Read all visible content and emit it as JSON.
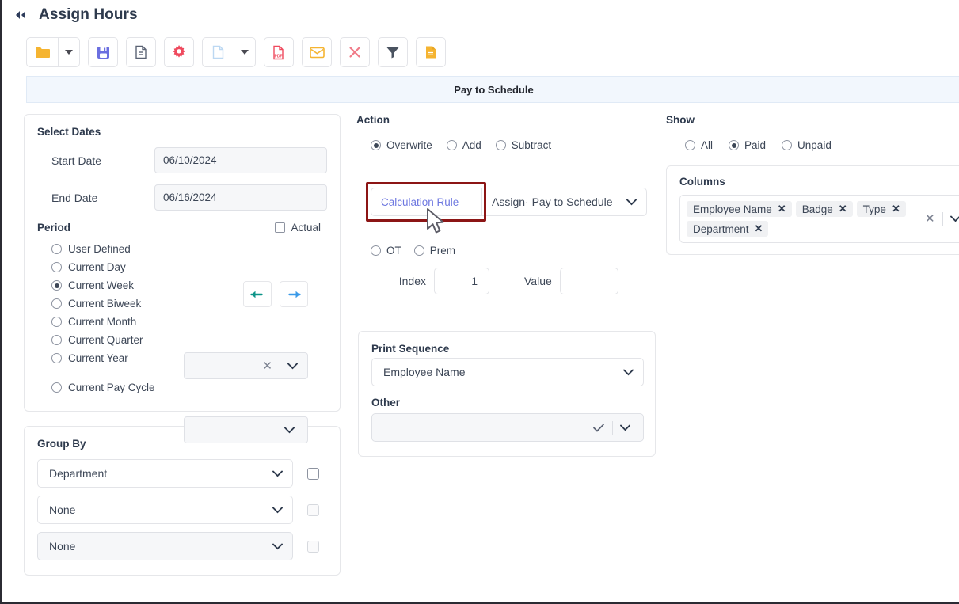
{
  "window": {
    "collapse_icon": "double-chevron-left-icon",
    "title": "Assign Hours"
  },
  "toolbar": {
    "buttons": [
      {
        "name": "open-folder-button",
        "icon": "folder-icon",
        "color": "#f5b431",
        "has_caret": true
      },
      {
        "name": "save-button",
        "icon": "floppy-disk-icon",
        "color": "#6b6fe0",
        "has_caret": false
      },
      {
        "name": "report-button",
        "icon": "document-lines-icon",
        "color": "#5b6374",
        "has_caret": false
      },
      {
        "name": "settings-button",
        "icon": "gear-icon",
        "color": "#ef4a5e",
        "has_caret": false
      },
      {
        "name": "new-document-button",
        "icon": "blank-page-icon",
        "color": "#bcd8f2",
        "has_caret": true
      },
      {
        "name": "export-pdf-button",
        "icon": "pdf-icon",
        "color": "#ef4a5e",
        "has_caret": false
      },
      {
        "name": "email-button",
        "icon": "envelope-icon",
        "color": "#f5b431",
        "has_caret": false
      },
      {
        "name": "delete-button",
        "icon": "close-x-icon",
        "color": "#f07a87",
        "has_caret": false
      },
      {
        "name": "filter-button",
        "icon": "funnel-icon",
        "color": "#5b6374",
        "has_caret": false
      },
      {
        "name": "notes-button",
        "icon": "document-orange-icon",
        "color": "#f5b431",
        "has_caret": false
      }
    ]
  },
  "section": {
    "title": "Pay to Schedule"
  },
  "select_dates": {
    "title": "Select Dates",
    "start_label": "Start Date",
    "start_value": "06/10/2024",
    "end_label": "End Date",
    "end_value": "06/16/2024",
    "period_label": "Period",
    "actual_label": "Actual",
    "actual_checked": false,
    "periods": [
      {
        "label": "User Defined",
        "checked": false
      },
      {
        "label": "Current Day",
        "checked": false
      },
      {
        "label": "Current Week",
        "checked": true
      },
      {
        "label": "Current Biweek",
        "checked": false
      },
      {
        "label": "Current Month",
        "checked": false
      },
      {
        "label": "Current Quarter",
        "checked": false
      },
      {
        "label": "Current Year",
        "checked": false
      }
    ],
    "pay_cycle": {
      "label": "Current Pay Cycle",
      "checked": false,
      "value": ""
    },
    "quarter_year_select_value": "",
    "prev_arrow_color": "#0d9488",
    "next_arrow_color": "#3b9ae8"
  },
  "group_by": {
    "title": "Group By",
    "rows": [
      {
        "value": "Department",
        "checked": false,
        "muted": false
      },
      {
        "value": "None",
        "checked": false,
        "muted": true
      },
      {
        "value": "None",
        "checked": false,
        "muted": true
      }
    ]
  },
  "action": {
    "title": "Action",
    "options": [
      {
        "label": "Overwrite",
        "checked": true
      },
      {
        "label": "Add",
        "checked": false
      },
      {
        "label": "Subtract",
        "checked": false
      }
    ],
    "calculation_rule_button": "Calculation Rule",
    "calculation_rule_select": "Assign· Pay to Schedule",
    "highlight_color": "#8c1515",
    "link_color": "#6e78e0",
    "ot_prem": [
      {
        "label": "OT",
        "checked": false
      },
      {
        "label": "Prem",
        "checked": false
      }
    ],
    "index_label": "Index",
    "index_value": "1",
    "value_label": "Value",
    "value_value": ""
  },
  "print_sequence": {
    "title": "Print Sequence",
    "sequence_value": "Employee Name",
    "other_label": "Other",
    "other_value": ""
  },
  "show": {
    "title": "Show",
    "options": [
      {
        "label": "All",
        "checked": false
      },
      {
        "label": "Paid",
        "checked": true
      },
      {
        "label": "Unpaid",
        "checked": false
      }
    ]
  },
  "columns": {
    "title": "Columns",
    "chips": [
      "Employee Name",
      "Badge",
      "Type",
      "Department"
    ],
    "remove_glyph": "✕"
  }
}
